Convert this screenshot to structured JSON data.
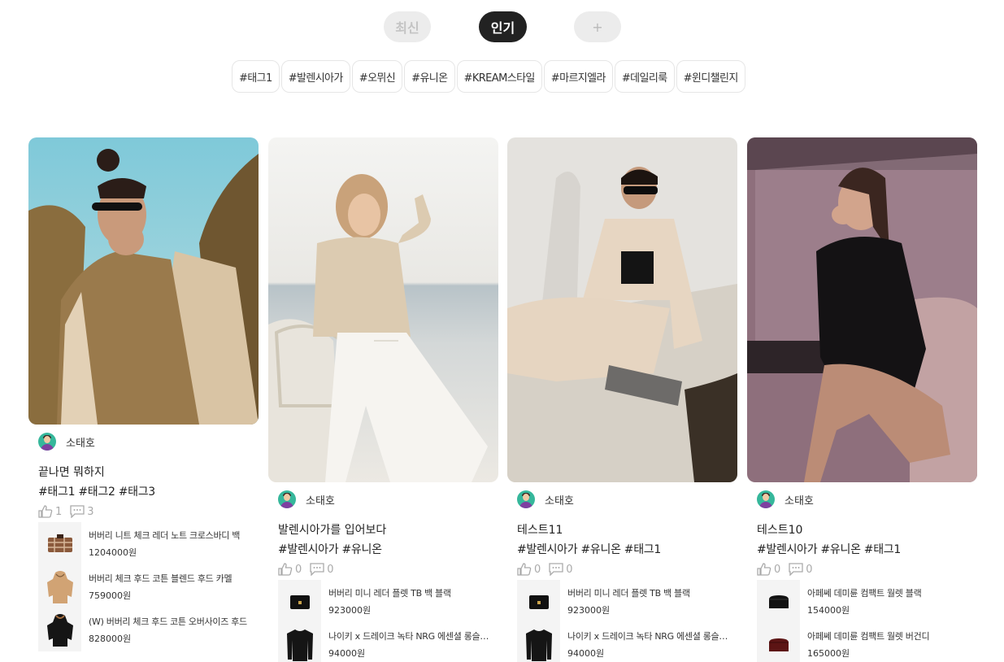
{
  "tabs": {
    "latest": "최신",
    "popular": "인기",
    "add": "+"
  },
  "tags": [
    "#태그1",
    "#발렌시아가",
    "#오뮈신",
    "#유니온",
    "#KREAM스타일",
    "#마르지엘라",
    "#데일리룩",
    "#윈디챌린지"
  ],
  "colors": {
    "accent": "#222222",
    "tab_inactive_bg": "#ececec",
    "avatar_bg": "#36b79b"
  },
  "posts": [
    {
      "author": "소태호",
      "title": "끝나면 뭐하지",
      "hashtags": "#태그1 #태그2 #태그3",
      "likes": "1",
      "comments": "3",
      "products": [
        {
          "name": "버버리 니트 체크 레더 노트 크로스바디 백",
          "price": "1204000원",
          "icon": "check-bag-icon"
        },
        {
          "name": "버버리 체크 후드 코튼 블렌드 후드 카멜",
          "price": "759000원",
          "icon": "camel-hoodie-icon"
        },
        {
          "name": "(W) 버버리 체크 후드 코튼 오버사이즈 후드",
          "price": "828000원",
          "icon": "black-hoodie-icon"
        }
      ]
    },
    {
      "author": "소태호",
      "title": "발렌시아가를 입어보다",
      "hashtags": "#발렌시아가 #유니온",
      "likes": "0",
      "comments": "0",
      "products": [
        {
          "name": "버버리 미니 레더 플렛 TB 백 블랙",
          "price": "923000원",
          "icon": "black-bag-icon"
        },
        {
          "name": "나이키 x 드레이크 녹타 NRG 에센셜 롱슬리브",
          "price": "94000원",
          "icon": "black-longsleeve-icon"
        }
      ]
    },
    {
      "author": "소태호",
      "title": "테스트11",
      "hashtags": "#발렌시아가 #유니온 #태그1",
      "likes": "0",
      "comments": "0",
      "products": [
        {
          "name": "버버리 미니 레더 플렛 TB 백 블랙",
          "price": "923000원",
          "icon": "black-bag-icon"
        },
        {
          "name": "나이키 x 드레이크 녹타 NRG 에센셜 롱슬리브",
          "price": "94000원",
          "icon": "black-longsleeve-icon"
        }
      ]
    },
    {
      "author": "소태호",
      "title": "테스트10",
      "hashtags": "#발렌시아가 #유니온 #태그1",
      "likes": "0",
      "comments": "0",
      "products": [
        {
          "name": "아페쎄 데미륜 컴팩트 월렛 블랙",
          "price": "154000원",
          "icon": "black-wallet-icon"
        },
        {
          "name": "아페쎄 데미륜 컴팩트 월렛 버건디",
          "price": "165000원",
          "icon": "burgundy-wallet-icon"
        }
      ]
    }
  ]
}
